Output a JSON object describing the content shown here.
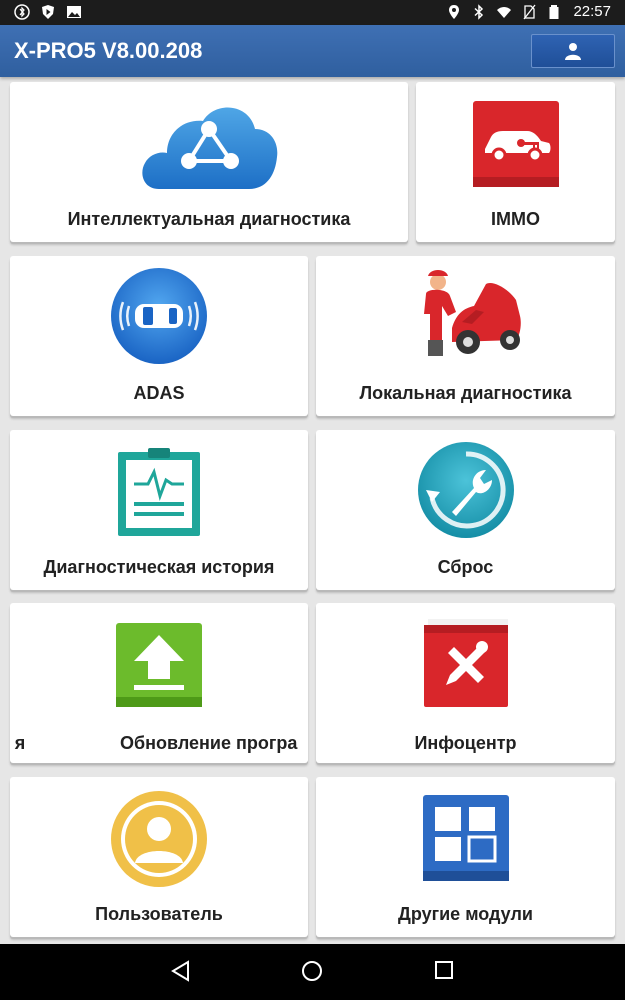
{
  "status_bar": {
    "time": "22:57",
    "left_icons": [
      "bluetooth-app-icon",
      "shield-play-icon",
      "image-icon"
    ],
    "right_icons": [
      "location-icon",
      "bluetooth-icon",
      "wifi-icon",
      "no-sim-icon",
      "battery-icon"
    ]
  },
  "app_bar": {
    "title": "X-PRO5 V8.00.208",
    "user_button_icon": "user-icon"
  },
  "tiles": {
    "smart_diag": {
      "label": "Интеллектуальная диагностика",
      "icon": "cloud-share-icon"
    },
    "immo": {
      "label": "IMMO",
      "icon": "car-key-icon"
    },
    "adas": {
      "label": "ADAS",
      "icon": "car-radar-icon"
    },
    "local_diag": {
      "label": "Локальная диагностика",
      "icon": "mechanic-car-icon"
    },
    "history": {
      "label": "Диагностическая история",
      "icon": "clipboard-chart-icon"
    },
    "reset": {
      "label": "Сброс",
      "icon": "wrench-reset-icon"
    },
    "update": {
      "label_left": "я",
      "label": "Обновление програ",
      "icon": "upload-arrow-icon"
    },
    "infocenter": {
      "label": "Инфоцентр",
      "icon": "repair-book-icon"
    },
    "user": {
      "label": "Пользователь",
      "icon": "user-circle-icon"
    },
    "other": {
      "label": "Другие модули",
      "icon": "modules-grid-icon"
    }
  },
  "colors": {
    "app_bar": "#3f70b4",
    "background": "#e6e6e6",
    "immo_red": "#d9262b",
    "update_green": "#6cbb2c",
    "reset_teal": "#22a1b9"
  },
  "nav_bar": {
    "buttons": [
      "back-icon",
      "home-icon",
      "recents-icon"
    ]
  }
}
